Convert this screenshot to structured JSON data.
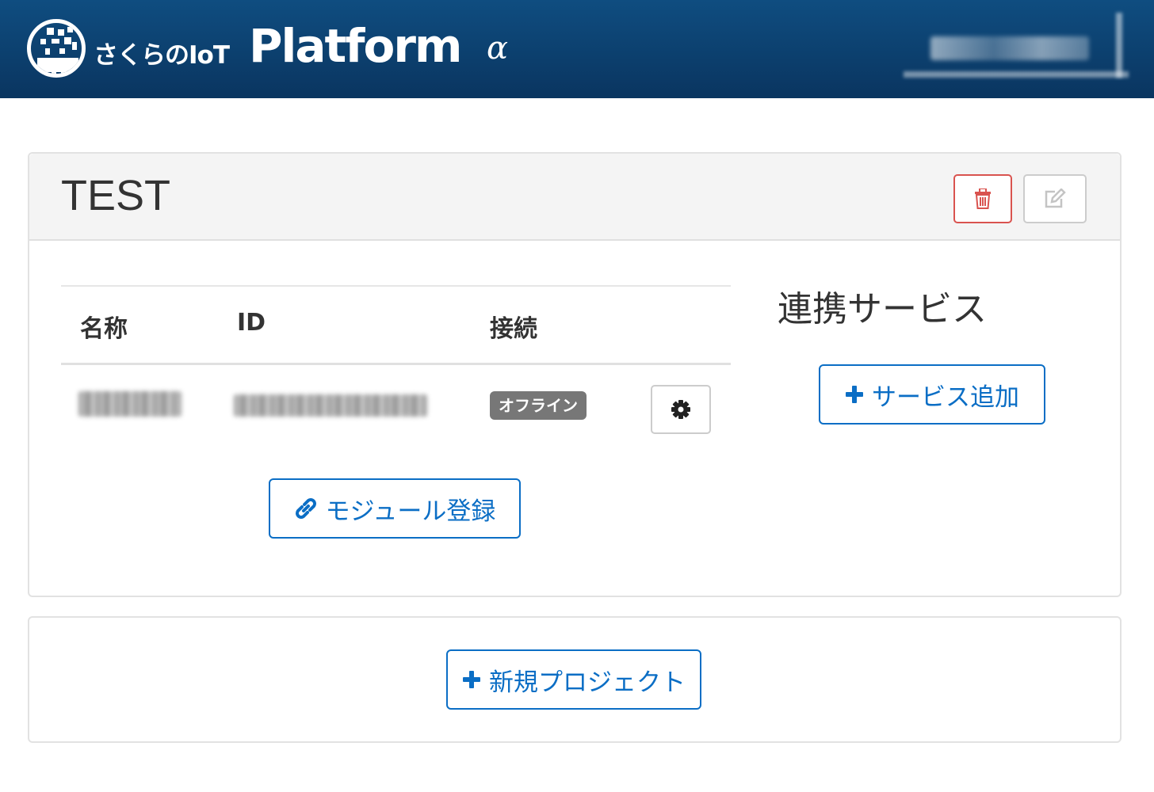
{
  "header": {
    "brand_jp": "さくらのIoT",
    "brand_en": "Platform",
    "brand_alpha": "α",
    "logo_icon": "sakura-iot-logo-icon",
    "user_menu": {
      "icon": "user-icon",
      "caret_icon": "caret-down-icon"
    }
  },
  "project": {
    "name": "TEST",
    "delete_icon": "trash-icon",
    "edit_icon": "edit-icon",
    "table": {
      "headers": [
        "名称",
        "ID",
        "接続"
      ],
      "rows": [
        {
          "status": "オフライン",
          "settings_icon": "gear-icon"
        }
      ]
    },
    "module_button": {
      "icon": "link-icon",
      "label": "モジュール登録"
    },
    "services": {
      "title": "連携サービス",
      "add_button": {
        "icon": "plus-icon",
        "label": "サービス追加"
      }
    }
  },
  "new_project": {
    "icon": "plus-icon",
    "label": "新規プロジェクト"
  },
  "colors": {
    "navbar": "#0a3d6b",
    "primary": "#0b6ec5",
    "danger": "#d9534f",
    "badge": "#777777"
  }
}
